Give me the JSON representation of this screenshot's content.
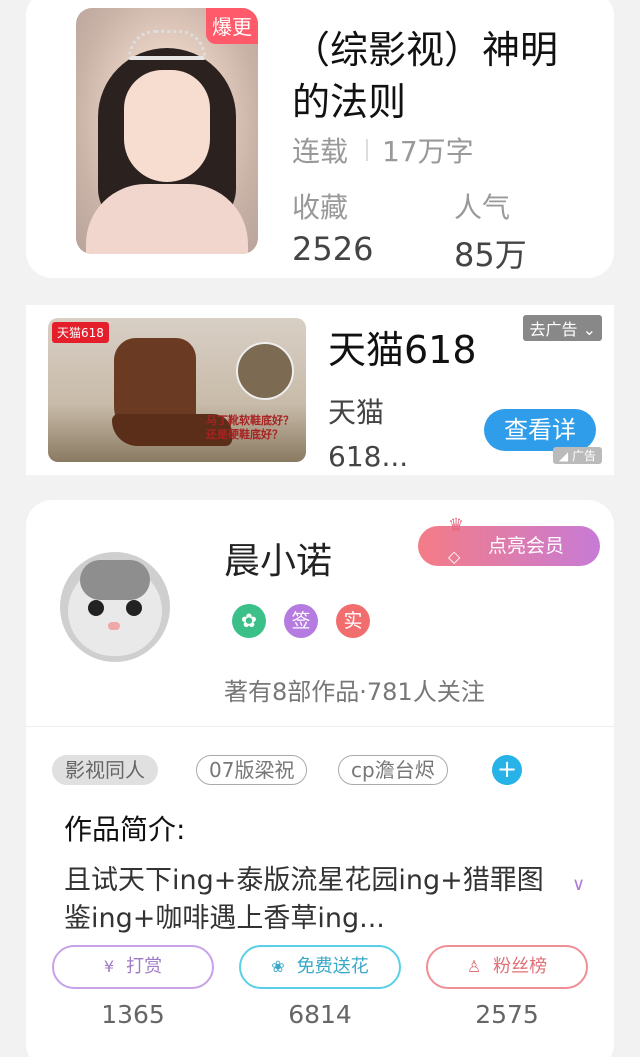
{
  "book": {
    "cover_badge": "爆更",
    "title": "（综影视）神明的法则",
    "status": "连载",
    "word_count": "17万字",
    "favorites_label": "收藏",
    "favorites_value": "2526",
    "popularity_label": "人气",
    "popularity_value": "85万"
  },
  "ad": {
    "image_logo": "天猫618",
    "image_question": "马丁靴软鞋底好？还是硬鞋底好？",
    "title": "天猫618",
    "description": "天猫618...",
    "close_label": "去广告",
    "button_label": "查看详",
    "ad_mark": "广告"
  },
  "author": {
    "name": "晨小诺",
    "vip_button": "点亮会员",
    "badges": [
      {
        "icon": "handshake-icon",
        "color": "#3cc08a",
        "text": "✿"
      },
      {
        "icon": "sign-icon",
        "color": "#b57be0",
        "text": "签"
      },
      {
        "icon": "verified-icon",
        "color": "#f26e6e",
        "text": "实"
      }
    ],
    "stats": "著有8部作品·781人关注",
    "tags": [
      "影视同人",
      "07版梁祝",
      "cp澹台烬"
    ],
    "intro_title": "作品简介:",
    "intro_text": "且试天下ing+泰版流星花园ing+猎罪图鉴ing+咖啡遇上香草ing...",
    "actions": [
      {
        "label": "打赏",
        "icon": "yen-icon",
        "count": "1365"
      },
      {
        "label": "免费送花",
        "icon": "flower-icon",
        "count": "6814"
      },
      {
        "label": "粉丝榜",
        "icon": "user-icon",
        "count": "2575"
      }
    ]
  }
}
